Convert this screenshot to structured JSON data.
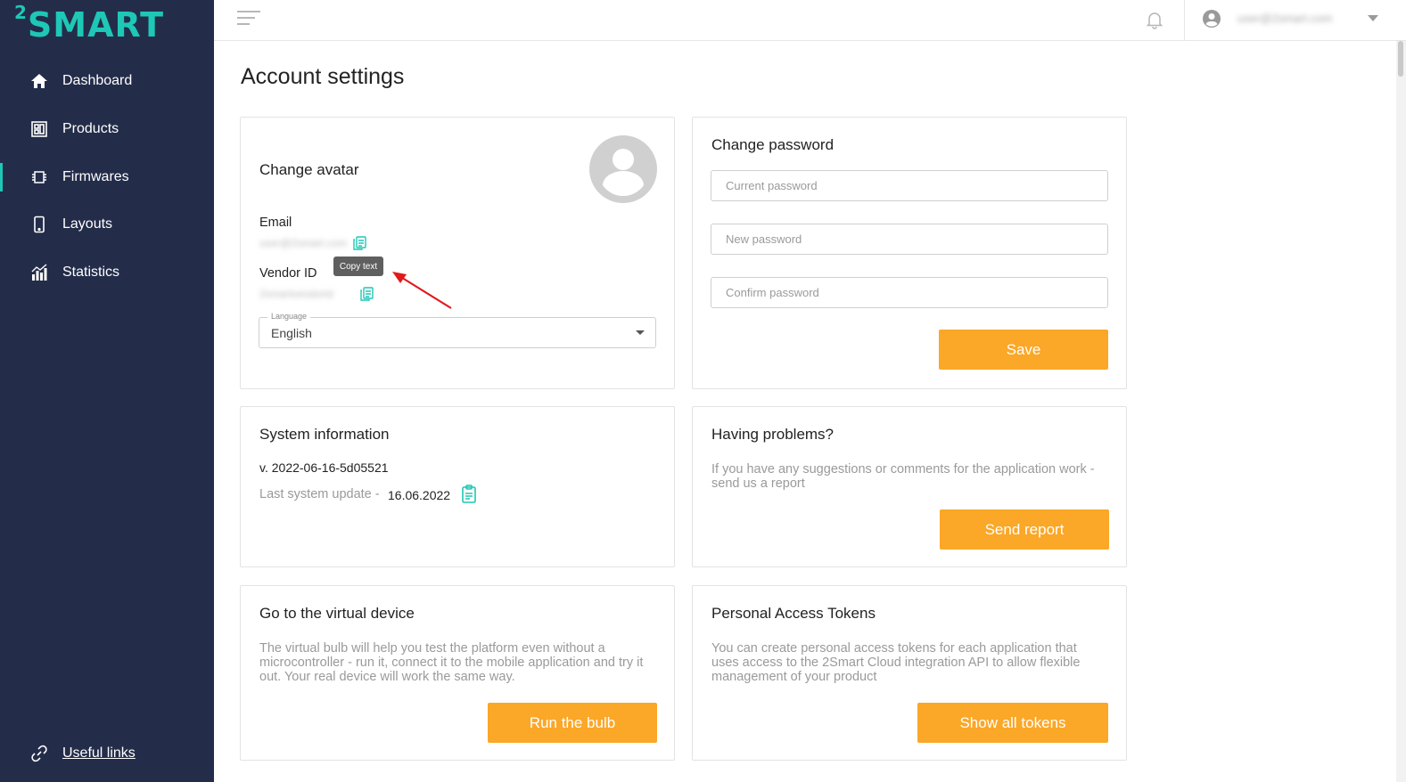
{
  "app": {
    "logo_prefix": "2",
    "logo_text": "SMART"
  },
  "sidebar": {
    "items": [
      {
        "label": "Dashboard",
        "icon": "home-icon"
      },
      {
        "label": "Products",
        "icon": "products-icon"
      },
      {
        "label": "Firmwares",
        "icon": "chip-icon"
      },
      {
        "label": "Layouts",
        "icon": "phone-icon"
      },
      {
        "label": "Statistics",
        "icon": "bar-chart-icon"
      }
    ],
    "useful_links": "Useful links"
  },
  "topbar": {
    "user_email": "user@2smart.com"
  },
  "page": {
    "title": "Account settings"
  },
  "avatar_card": {
    "title": "Change avatar",
    "email_label": "Email",
    "email_value": "user@2smart.com",
    "vendor_label": "Vendor ID",
    "vendor_value": "2smartvendorid",
    "tooltip": "Copy text",
    "language_label": "Language",
    "language_value": "English"
  },
  "password_card": {
    "title": "Change password",
    "current_placeholder": "Current password",
    "new_placeholder": "New password",
    "confirm_placeholder": "Confirm password",
    "save_label": "Save"
  },
  "system_card": {
    "title": "System information",
    "version": "v. 2022-06-16-5d05521",
    "last_update_label": "Last system update -",
    "last_update_value": "16.06.2022"
  },
  "problems_card": {
    "title": "Having problems?",
    "description_line1": "If you have any suggestions or comments for the application work -",
    "description_line2": "send us a report",
    "button": "Send report"
  },
  "virtual_card": {
    "title": "Go to the virtual device",
    "description_line1": "The virtual bulb will help you test the platform even without a",
    "description_line2": "microcontroller - run it, connect it to the mobile application and try it",
    "description_line3": "out. Your real device will work the same way.",
    "button": "Run the bulb"
  },
  "tokens_card": {
    "title": "Personal Access Tokens",
    "description_line1": "You can create personal access tokens for each application that",
    "description_line2": "uses access to the 2Smart Cloud integration API to allow flexible",
    "description_line3": "management of your product",
    "button": "Show all tokens"
  },
  "colors": {
    "sidebar": "#232d4a",
    "accent": "#1ec7b6",
    "button": "#fba727",
    "annotation_arrow": "#e0191c"
  }
}
